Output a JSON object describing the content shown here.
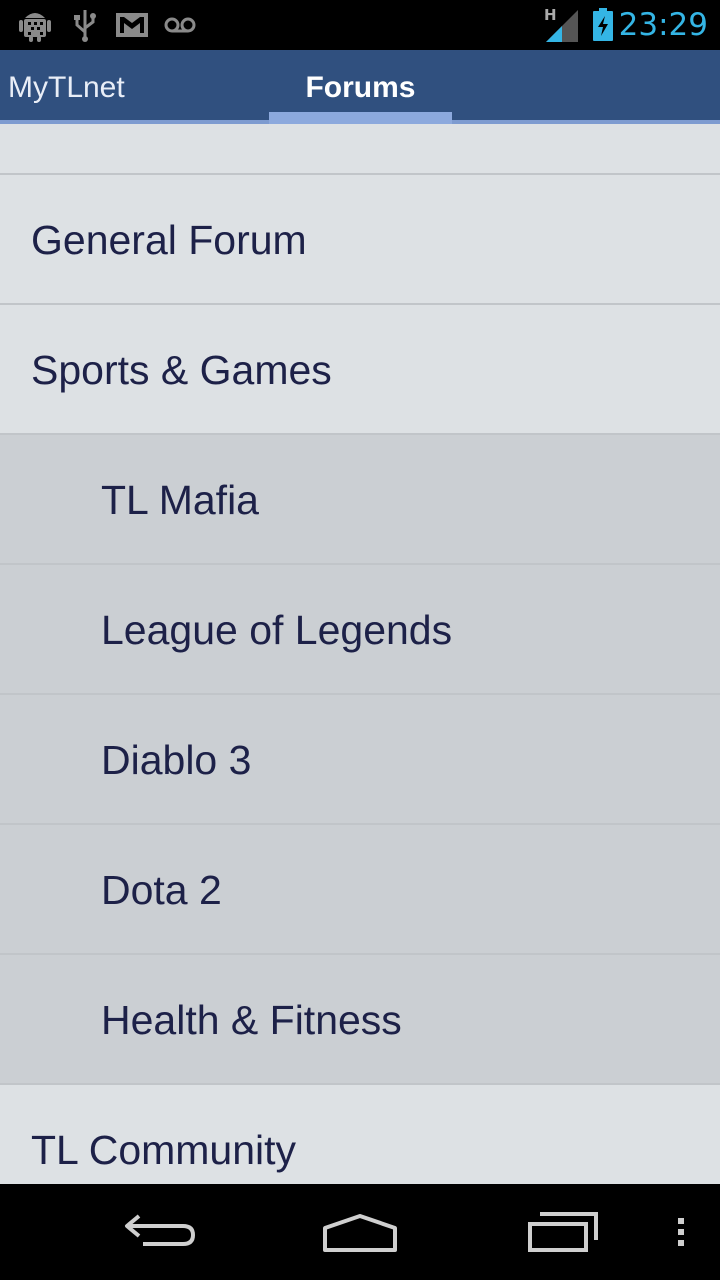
{
  "status_bar": {
    "time": "23:29",
    "network_label": "H",
    "accent_color": "#34b5e5",
    "icons": [
      "android-debug-icon",
      "usb-icon",
      "gmail-icon",
      "voicemail-icon",
      "signal-icon",
      "battery-charging-icon"
    ]
  },
  "tabs": {
    "left_label": "MyTLnet",
    "active_label": "Forums"
  },
  "forums": {
    "items": [
      {
        "label": "General Forum",
        "level": 0
      },
      {
        "label": "Sports & Games",
        "level": 0
      },
      {
        "label": "TL Mafia",
        "level": 1
      },
      {
        "label": "League of Legends",
        "level": 1
      },
      {
        "label": "Diablo 3",
        "level": 1
      },
      {
        "label": "Dota 2",
        "level": 1
      },
      {
        "label": "Health & Fitness",
        "level": 1
      },
      {
        "label": "TL Community",
        "level": 0
      }
    ]
  },
  "nav_bar": {
    "icons": [
      "back-icon",
      "home-icon",
      "recent-apps-icon",
      "overflow-menu-icon"
    ]
  },
  "colors": {
    "action_bar": "#30507f",
    "tab_indicator": "#8ca9dd",
    "list_text": "#1d2148",
    "category_bg": "#dde1e4",
    "subforum_bg": "#cbcfd3"
  }
}
